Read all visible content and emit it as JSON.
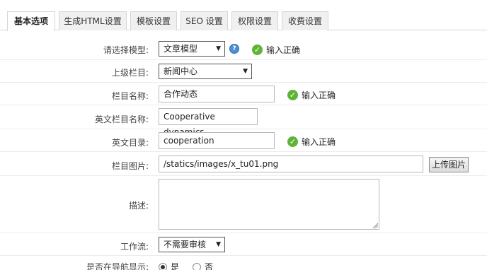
{
  "tabs": [
    {
      "label": "基本选项",
      "active": true
    },
    {
      "label": "生成HTML设置",
      "active": false
    },
    {
      "label": "模板设置",
      "active": false
    },
    {
      "label": "SEO 设置",
      "active": false
    },
    {
      "label": "权限设置",
      "active": false
    },
    {
      "label": "收费设置",
      "active": false
    }
  ],
  "form": {
    "model": {
      "label": "请选择模型:",
      "value": "文章模型",
      "status": "输入正确"
    },
    "parent": {
      "label": "上级栏目:",
      "value": "新闻中心"
    },
    "name": {
      "label": "栏目名称:",
      "value": "合作动态",
      "status": "输入正确"
    },
    "en_name": {
      "label": "英文栏目名称:",
      "value": "Cooperative dynamics"
    },
    "en_dir": {
      "label": "英文目录:",
      "value": "cooperation",
      "status": "输入正确"
    },
    "image": {
      "label": "栏目图片:",
      "value": "/statics/images/x_tu01.png",
      "button": "上传图片"
    },
    "description": {
      "label": "描述:",
      "value": ""
    },
    "workflow": {
      "label": "工作流:",
      "value": "不需要审核"
    },
    "nav_display": {
      "label": "是否在导航显示:",
      "options": [
        {
          "label": "是",
          "checked": true
        },
        {
          "label": "否",
          "checked": false
        }
      ]
    }
  },
  "colors": {
    "check": "#5fb336",
    "help": "#4d8fd1"
  }
}
